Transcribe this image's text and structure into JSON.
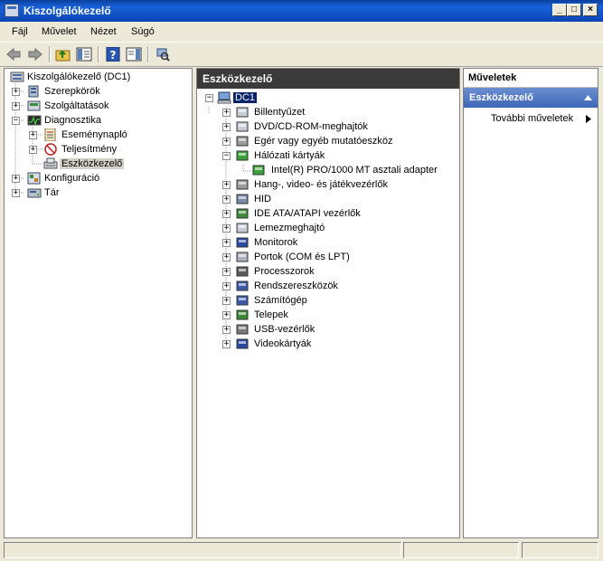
{
  "window": {
    "title": "Kiszolgálókezelő"
  },
  "menu": [
    "Fájl",
    "Művelet",
    "Nézet",
    "Súgó"
  ],
  "left_tree": {
    "root": "Kiszolgálókezelő (DC1)",
    "items": [
      "Szerepkörök",
      "Szolgáltatások",
      "Diagnosztika",
      "Eseménynapló",
      "Teljesítmény",
      "Eszközkezelő",
      "Konfiguráció",
      "Tár"
    ]
  },
  "center": {
    "header": "Eszközkezelő",
    "root": "DC1",
    "devices": [
      "Billentyűzet",
      "DVD/CD-ROM-meghajtók",
      "Egér vagy egyéb mutatóeszköz",
      "Hálózati kártyák",
      "Intel(R) PRO/1000 MT asztali adapter",
      "Hang-, video- és játékvezérlők",
      "HID",
      "IDE ATA/ATAPI vezérlők",
      "Lemezmeghajtó",
      "Monitorok",
      "Portok (COM és LPT)",
      "Processzorok",
      "Rendszereszközök",
      "Számítógép",
      "Telepek",
      "USB-vezérlők",
      "Videokártyák"
    ]
  },
  "actions": {
    "header": "Műveletek",
    "section": "Eszközkezelő",
    "more": "További műveletek"
  }
}
